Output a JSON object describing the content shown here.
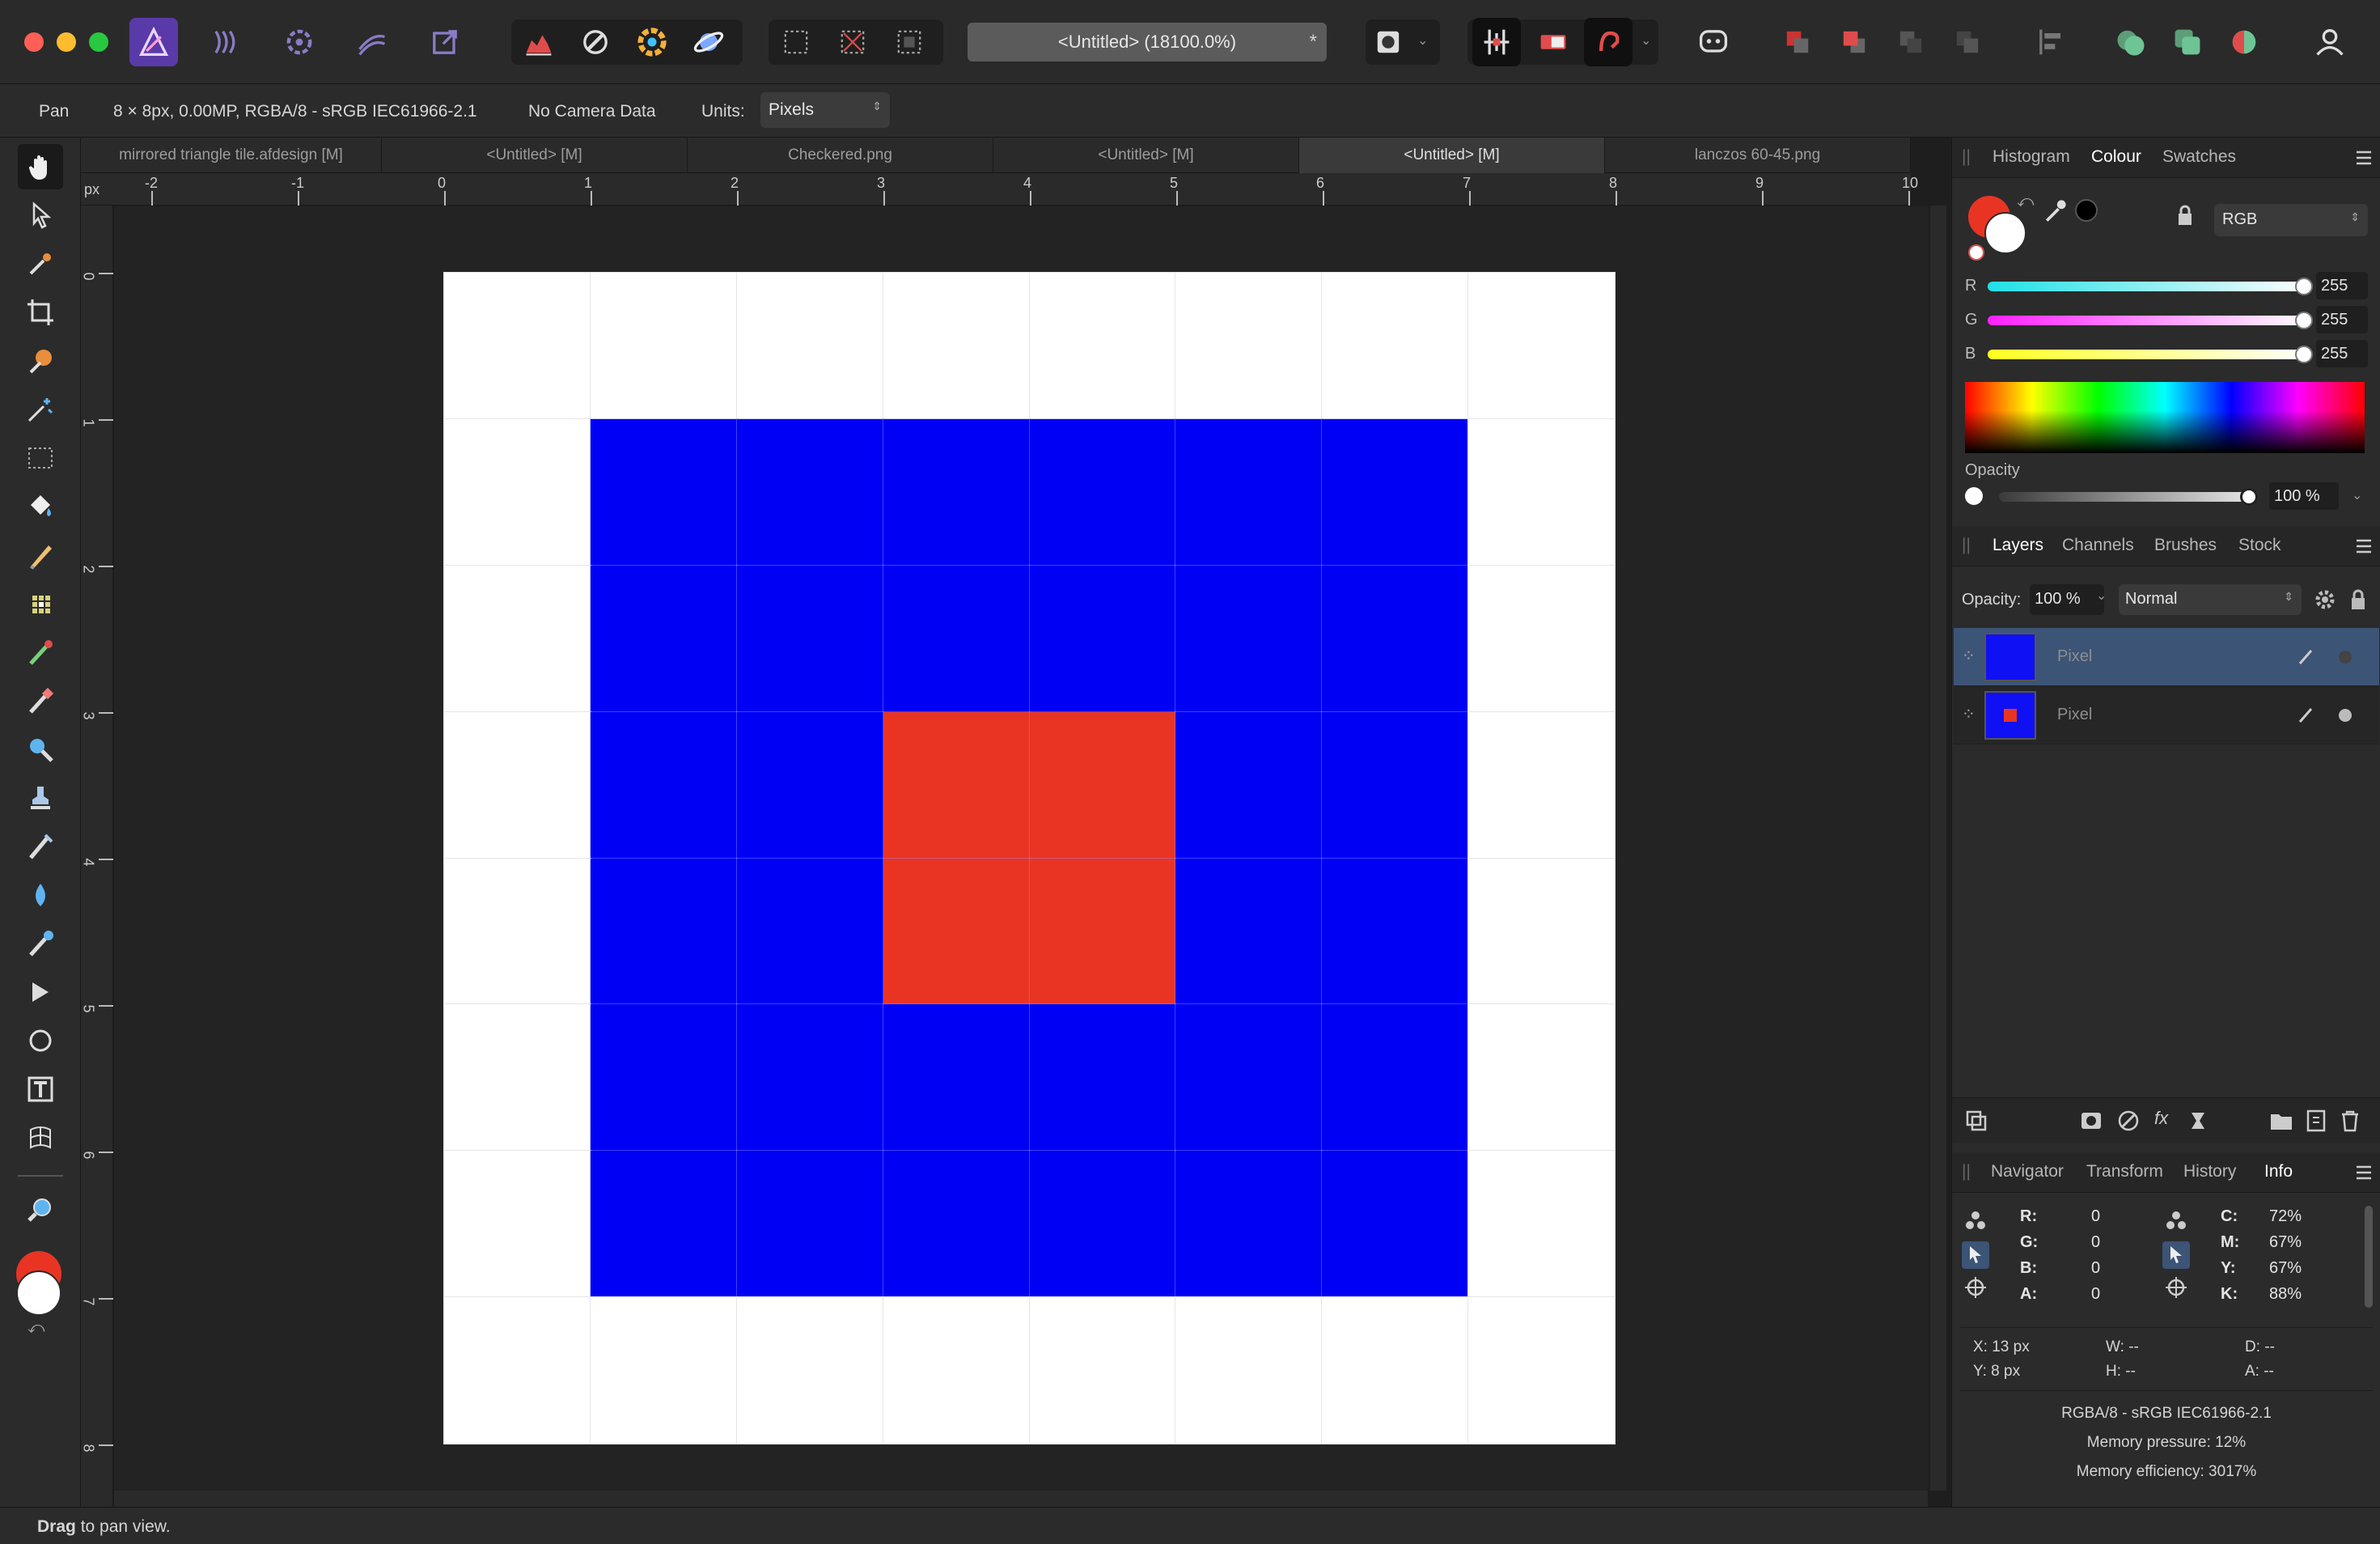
{
  "window": {
    "doc_title": "<Untitled> (18100.0%)",
    "doc_modified": "*"
  },
  "context_bar": {
    "tool": "Pan",
    "doc_info": "8 × 8px, 0.00MP, RGBA/8 - sRGB IEC61966-2.1",
    "camera": "No Camera Data",
    "units_label": "Units:",
    "units_value": "Pixels"
  },
  "tabs": [
    "mirrored triangle tile.afdesign [M]",
    "<Untitled> [M]",
    "Checkered.png",
    "<Untitled> [M]",
    "<Untitled> [M]",
    "lanczos 60-45.png"
  ],
  "active_tab": 4,
  "ruler": {
    "unit": "px",
    "h": [
      "-2",
      "-1",
      "0",
      "1",
      "2",
      "3",
      "4",
      "5",
      "6",
      "7",
      "8",
      "9",
      "10"
    ],
    "v": [
      "0",
      "1",
      "2",
      "3",
      "4",
      "5",
      "6",
      "7",
      "8"
    ]
  },
  "canvas": {
    "grid": [
      "WWWWWWWW",
      "WBBBBBBW",
      "WBBBBBBW",
      "WBBRRBBW",
      "WBBRRBBW",
      "WBBBBBBW",
      "WBBBBBBW",
      "WWWWWWWW"
    ],
    "colors": {
      "W": "#ffffff",
      "B": "#0000f5",
      "R": "#e93423"
    }
  },
  "colour_panel": {
    "tabs": [
      "Histogram",
      "Colour",
      "Swatches"
    ],
    "active": "Colour",
    "mode": "RGB",
    "channels": [
      {
        "label": "R",
        "value": "255"
      },
      {
        "label": "G",
        "value": "255"
      },
      {
        "label": "B",
        "value": "255"
      }
    ],
    "opacity_label": "Opacity",
    "opacity_value": "100 %",
    "primary": "#e93423",
    "secondary": "#ffffff"
  },
  "layers_panel": {
    "tabs": [
      "Layers",
      "Channels",
      "Brushes",
      "Stock"
    ],
    "active": "Layers",
    "opacity_label": "Opacity:",
    "opacity_value": "100 %",
    "blend": "Normal",
    "layers": [
      {
        "name": "Pixel",
        "selected": true
      },
      {
        "name": "Pixel",
        "selected": false
      }
    ]
  },
  "info_panel": {
    "tabs": [
      "Navigator",
      "Transform",
      "History",
      "Info"
    ],
    "active": "Info",
    "rgba": [
      {
        "k": "R:",
        "v": "0"
      },
      {
        "k": "G:",
        "v": "0"
      },
      {
        "k": "B:",
        "v": "0"
      },
      {
        "k": "A:",
        "v": "0"
      }
    ],
    "cmyk": [
      {
        "k": "C:",
        "v": "72%"
      },
      {
        "k": "M:",
        "v": "67%"
      },
      {
        "k": "Y:",
        "v": "67%"
      },
      {
        "k": "K:",
        "v": "88%"
      }
    ],
    "pos": {
      "x": "X: 13 px",
      "y": "Y: 8 px",
      "w": "W: --",
      "h": "H: --",
      "d": "D: --",
      "a": "A: --"
    },
    "footer": [
      "RGBA/8 - sRGB IEC61966-2.1",
      "Memory pressure: 12%",
      "Memory efficiency: 3017%"
    ]
  },
  "status": {
    "bold": "Drag",
    "rest": " to pan view."
  }
}
